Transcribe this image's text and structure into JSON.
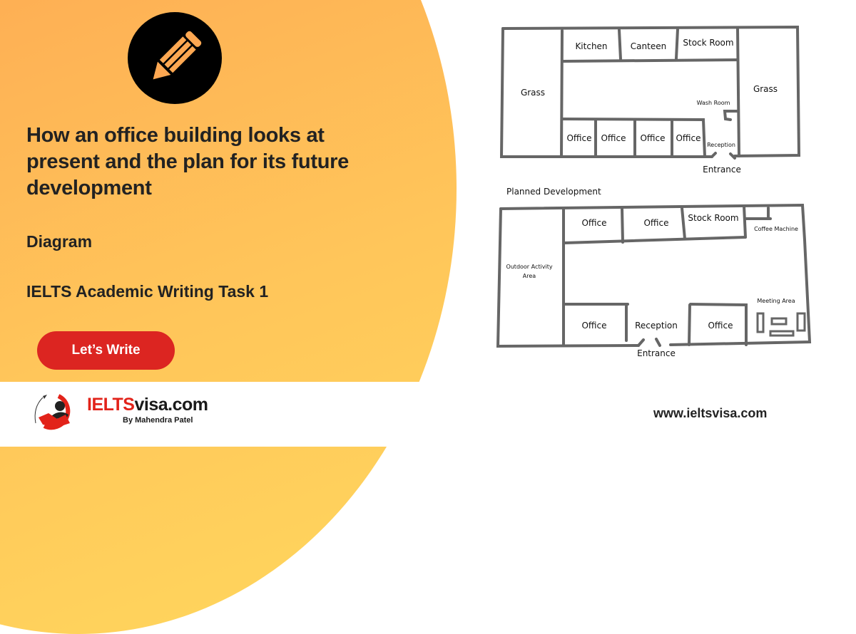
{
  "hero": {
    "title": "How an office building looks at present and the plan for its future development",
    "type_label": "Diagram",
    "task_label": "IELTS Academic Writing Task 1",
    "cta_label": "Let’s Write",
    "icon": "pencil-icon"
  },
  "colors": {
    "gradient_start": "#fd9c4e",
    "gradient_end": "#ffd85d",
    "cta": "#dc2521",
    "brand_red": "#e2231a",
    "text_dark": "#222222"
  },
  "brand": {
    "name_part1": "IELTS",
    "name_part2": "visa.com",
    "byline": "By Mahendra Patel",
    "website": "www.ieltsvisa.com"
  },
  "diagram": {
    "present": {
      "left_area": "Grass",
      "right_area": "Grass",
      "top_rooms": [
        "Kitchen",
        "Canteen",
        "Stock Room"
      ],
      "bottom_rooms": [
        "Office",
        "Office",
        "Office",
        "Office"
      ],
      "wash_room": "Wash Room",
      "reception": "Reception",
      "entrance": "Entrance"
    },
    "planned": {
      "heading": "Planned Development",
      "left_area_line1": "Outdoor Activity",
      "left_area_line2": "Area",
      "top_rooms": [
        "Office",
        "Office",
        "Stock Room"
      ],
      "coffee": "Coffee Machine",
      "meeting": "Meeting Area",
      "bottom_rooms": [
        "Office",
        "Reception",
        "Office"
      ],
      "entrance": "Entrance"
    }
  }
}
